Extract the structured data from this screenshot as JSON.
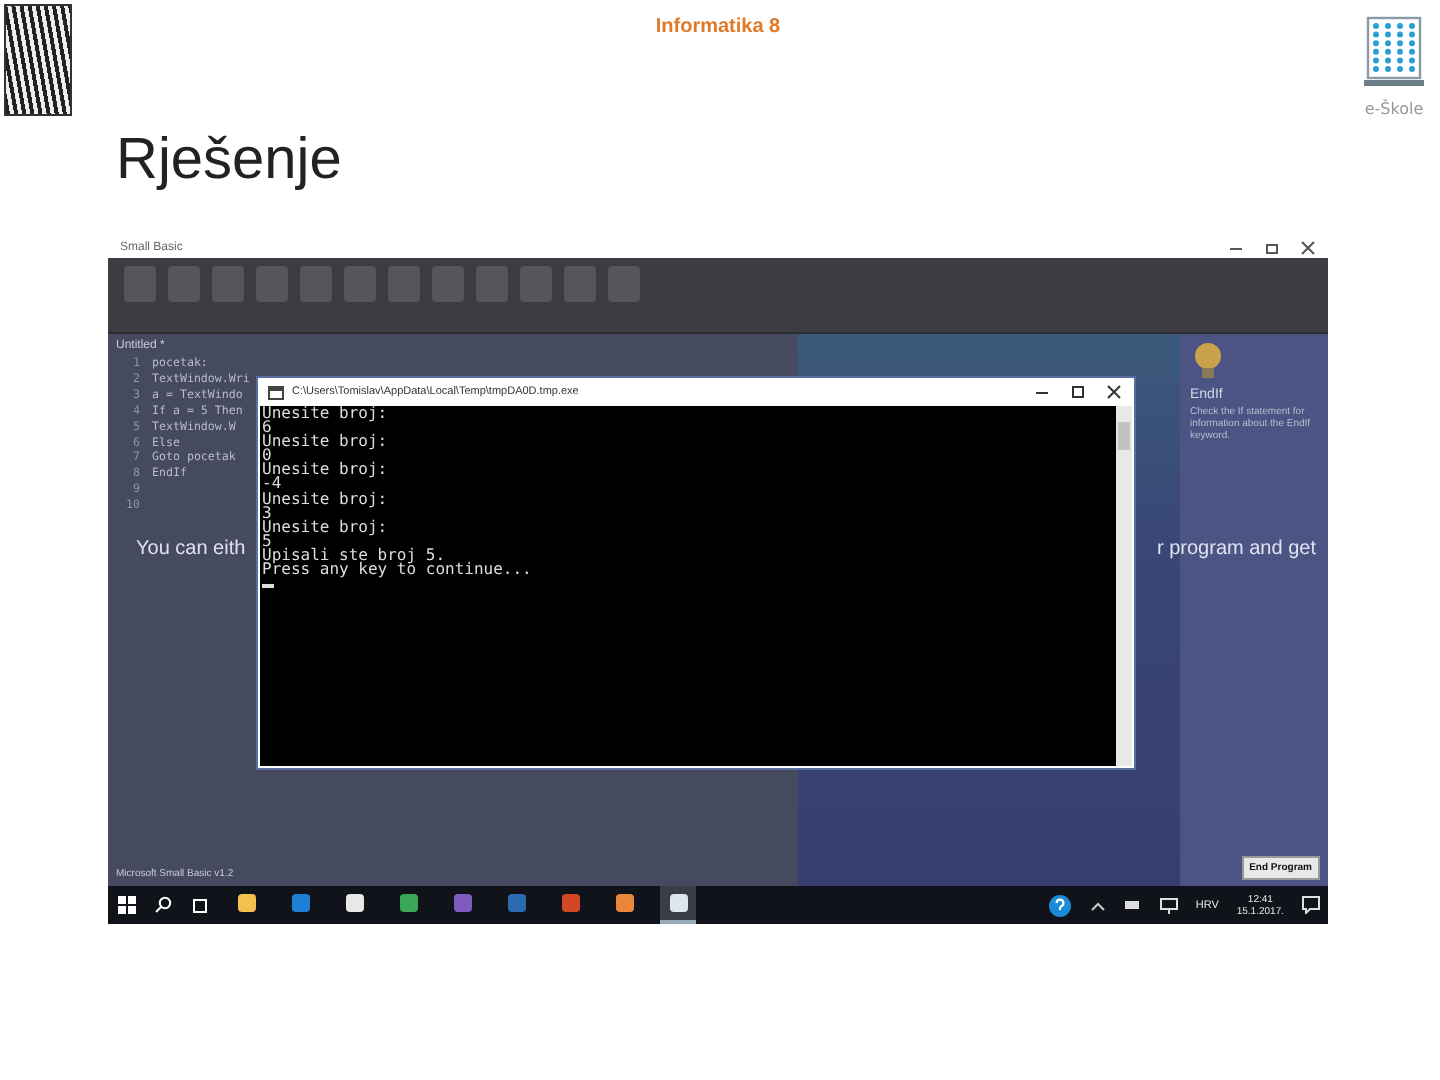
{
  "header": {
    "title": "Informatika 8",
    "brand": "e-Škole"
  },
  "slide": {
    "title": "Rješenje"
  },
  "screenshot": {
    "window_title": "Small Basic",
    "editor_tab": "Untitled *",
    "code_lines": [
      {
        "number": "1",
        "text": "pocetak:"
      },
      {
        "number": "2",
        "text": "TextWindow.Wri"
      },
      {
        "number": "3",
        "text": "a = TextWindo"
      },
      {
        "number": "4",
        "text": "If a = 5 Then"
      },
      {
        "number": "5",
        "text": "TextWindow.W"
      },
      {
        "number": "6",
        "text": "Else"
      },
      {
        "number": "7",
        "text": "Goto pocetak"
      },
      {
        "number": "8",
        "text": "EndIf"
      },
      {
        "number": "9"
      },
      {
        "number": "10"
      }
    ],
    "overlay_text": [
      "You can eith",
      "r program and get"
    ],
    "help": {
      "title": "EndIf",
      "text": "Check the If statement for information about the EndIf keyword."
    },
    "version": "Microsoft Small Basic v1.2",
    "end_button": "End Program",
    "console": {
      "title": "C:\\Users\\Tomislav\\AppData\\Local\\Temp\\tmpDA0D.tmp.exe",
      "lines": [
        "Unesite broj:",
        "6",
        "Unesite broj:",
        "0",
        "Unesite broj:",
        "-4",
        "Unesite broj:",
        "3",
        "Unesite broj:",
        "5",
        "Upisali ste broj 5.",
        "Press any key to continue..."
      ]
    },
    "taskbar": {
      "apps": [
        {
          "kind": "folder",
          "selected": false
        },
        {
          "kind": "edge",
          "selected": false
        },
        {
          "kind": "store",
          "selected": false
        },
        {
          "kind": "chrome",
          "selected": false
        },
        {
          "kind": "viber",
          "selected": false
        },
        {
          "kind": "document",
          "selected": false
        },
        {
          "kind": "powerpoint",
          "selected": false
        },
        {
          "kind": "photos",
          "selected": false
        },
        {
          "kind": "smallbasic",
          "selected": true
        }
      ],
      "language": "HRV",
      "time": "12:41",
      "date": "15.1.2017."
    }
  }
}
